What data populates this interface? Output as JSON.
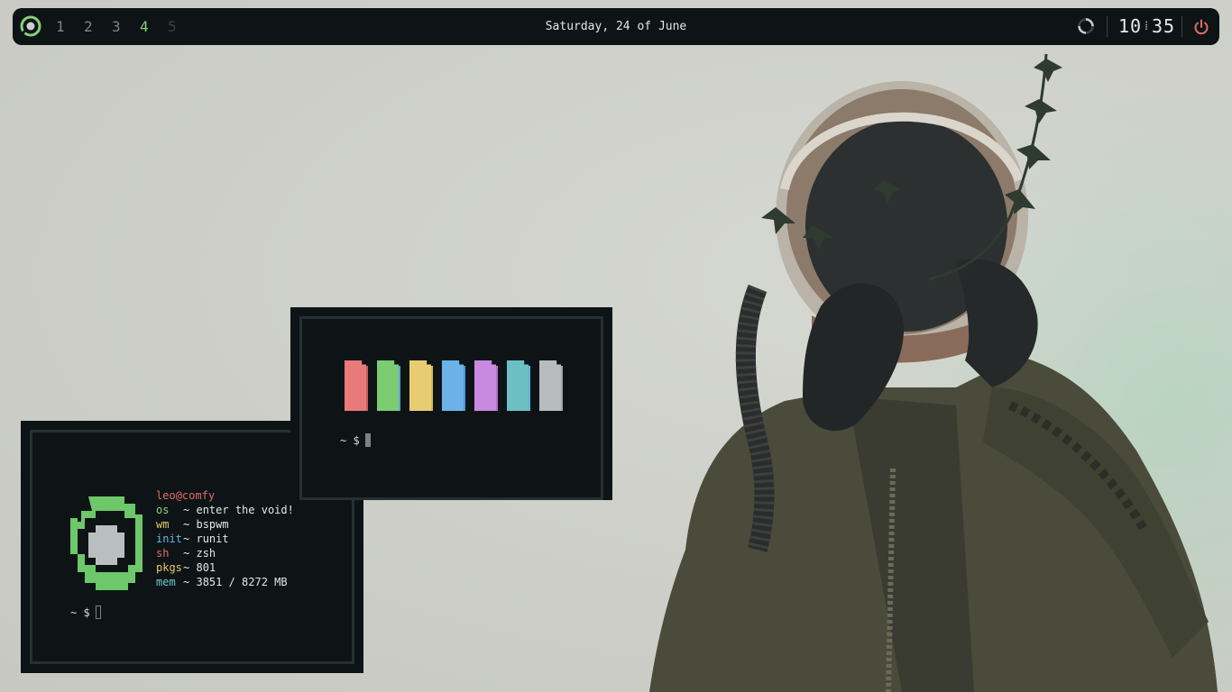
{
  "topbar": {
    "workspaces": [
      "1",
      "2",
      "3",
      "4",
      "5"
    ],
    "active_workspace": "4",
    "date": "Saturday, 24 of June",
    "time_hour": "10",
    "time_minute": "35",
    "icons": [
      "void-logo-icon",
      "loading-spinner-icon",
      "power-icon"
    ],
    "colors": {
      "bar_bg": "#0e1416",
      "active": "#86d07a",
      "power": "#e06c6c"
    }
  },
  "terminal_fetch": {
    "user": "leo",
    "at": "@",
    "host": "comfy",
    "rows": [
      {
        "key": "os",
        "sep": "~",
        "value": "enter the void!",
        "color": "#86d07a"
      },
      {
        "key": "wm",
        "sep": "~",
        "value": "bspwm",
        "color": "#e8c86e"
      },
      {
        "key": "init",
        "sep": "~",
        "value": "runit",
        "color": "#6cb2e8"
      },
      {
        "key": "sh",
        "sep": "~",
        "value": "zsh",
        "color": "#e06c6c"
      },
      {
        "key": "pkgs",
        "sep": "~",
        "value": "801",
        "color": "#e8c86e"
      },
      {
        "key": "mem",
        "sep": "~",
        "value": "3851 / 8272 MB",
        "color": "#6cc7d0"
      }
    ],
    "prompt": "~ $"
  },
  "terminal_colors": {
    "swatches": [
      {
        "front": "#e87a7a",
        "back": "#c65e5e"
      },
      {
        "front": "#7ccc72",
        "back": "#5aa8d8"
      },
      {
        "front": "#e8cc72",
        "back": "#d8b85a"
      },
      {
        "front": "#6cb2e8",
        "back": "#4f98d6"
      },
      {
        "front": "#c88ae0",
        "back": "#b070d0"
      },
      {
        "front": "#6cc0c4",
        "back": "#5ab8e0"
      },
      {
        "front": "#b8bcbc",
        "back": "#9ea4a4"
      }
    ],
    "prompt": "~ $"
  }
}
